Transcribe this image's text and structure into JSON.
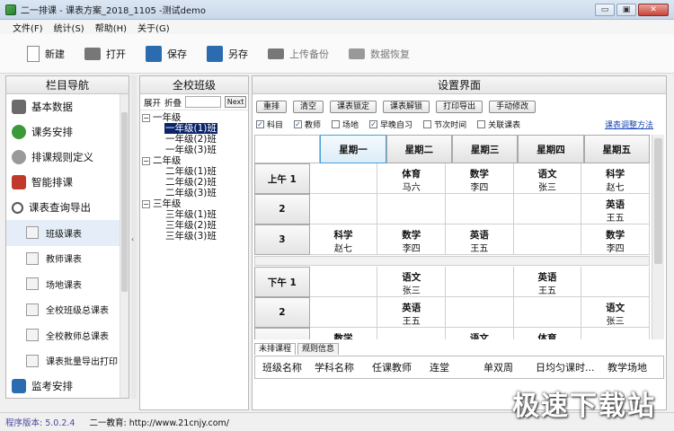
{
  "window": {
    "title": "二一排课 - 课表方案_2018_1105 -测试demo",
    "minimize_label": "▭",
    "restore_label": "▣",
    "close_label": "✕"
  },
  "menu": [
    "文件(F)",
    "统计(S)",
    "帮助(H)",
    "关于(G)"
  ],
  "toolbar": {
    "new": "新建",
    "open": "打开",
    "save": "保存",
    "saveas": "另存",
    "upload": "上传备份",
    "restore": "数据恢复"
  },
  "nav": {
    "title": "栏目导航",
    "items": [
      "基本数据",
      "课务安排",
      "排课规则定义",
      "智能排课",
      "课表查询导出"
    ],
    "subitems": [
      "班级课表",
      "教师课表",
      "场地课表",
      "全校班级总课表",
      "全校教师总课表",
      "课表批量导出打印"
    ],
    "last_item": "监考安排"
  },
  "classes": {
    "title": "全校班级",
    "expand": "展开",
    "collapse": "折叠",
    "next": "Next",
    "grades": [
      {
        "name": "一年级",
        "classes": [
          "一年级(1)班",
          "一年级(2)班",
          "一年级(3)班"
        ]
      },
      {
        "name": "二年级",
        "classes": [
          "二年级(1)班",
          "二年级(2)班",
          "二年级(3)班"
        ]
      },
      {
        "name": "三年级",
        "classes": [
          "三年级(1)班",
          "三年级(2)班",
          "三年级(3)班"
        ]
      }
    ]
  },
  "settings": {
    "title": "设置界面",
    "buttons": [
      "重排",
      "清空",
      "课表锁定",
      "课表解锁",
      "打印导出",
      "手动修改"
    ],
    "checks": [
      {
        "label": "科目",
        "checked": true
      },
      {
        "label": "教师",
        "checked": true
      },
      {
        "label": "场地",
        "checked": false
      },
      {
        "label": "早晚自习",
        "checked": true
      },
      {
        "label": "节次时间",
        "checked": false
      },
      {
        "label": "关联课表",
        "checked": false
      }
    ],
    "adjust_link": "课表调整方法"
  },
  "timetable": {
    "days": [
      "星期一",
      "星期二",
      "星期三",
      "星期四",
      "星期五"
    ],
    "morning": [
      {
        "label": "上午 1",
        "cells": [
          null,
          {
            "s": "体育",
            "t": "马六"
          },
          {
            "s": "数学",
            "t": "李四"
          },
          {
            "s": "语文",
            "t": "张三"
          },
          {
            "s": "科学",
            "t": "赵七"
          }
        ]
      },
      {
        "label": "2",
        "cells": [
          null,
          null,
          null,
          null,
          {
            "s": "英语",
            "t": "王五"
          }
        ]
      },
      {
        "label": "3",
        "cells": [
          {
            "s": "科学",
            "t": "赵七"
          },
          {
            "s": "数学",
            "t": "李四"
          },
          {
            "s": "英语",
            "t": "王五"
          },
          null,
          {
            "s": "数学",
            "t": "李四"
          }
        ]
      }
    ],
    "afternoon": [
      {
        "label": "下午 1",
        "cells": [
          null,
          {
            "s": "语文",
            "t": "张三"
          },
          null,
          {
            "s": "英语",
            "t": "王五"
          },
          null
        ]
      },
      {
        "label": "2",
        "cells": [
          null,
          {
            "s": "英语",
            "t": "王五"
          },
          null,
          null,
          {
            "s": "语文",
            "t": "张三"
          }
        ]
      },
      {
        "label": "",
        "cells": [
          {
            "s": "数学",
            "t": ""
          },
          null,
          {
            "s": "语文",
            "t": ""
          },
          {
            "s": "体育",
            "t": ""
          },
          null
        ]
      }
    ]
  },
  "bottom": {
    "tabs": [
      "未排课程",
      "规则信息"
    ],
    "columns": [
      "班级名称",
      "学科名称",
      "任课教师",
      "连堂",
      "单双周",
      "日均匀课时...",
      "教学场地"
    ]
  },
  "status": {
    "version": "程序版本: 5.0.2.4",
    "site": "二一教育: http://www.21cnjy.com/"
  },
  "watermark": "极速下载站",
  "colors": {
    "accent": "#0a246a",
    "link": "#1a46b3"
  }
}
